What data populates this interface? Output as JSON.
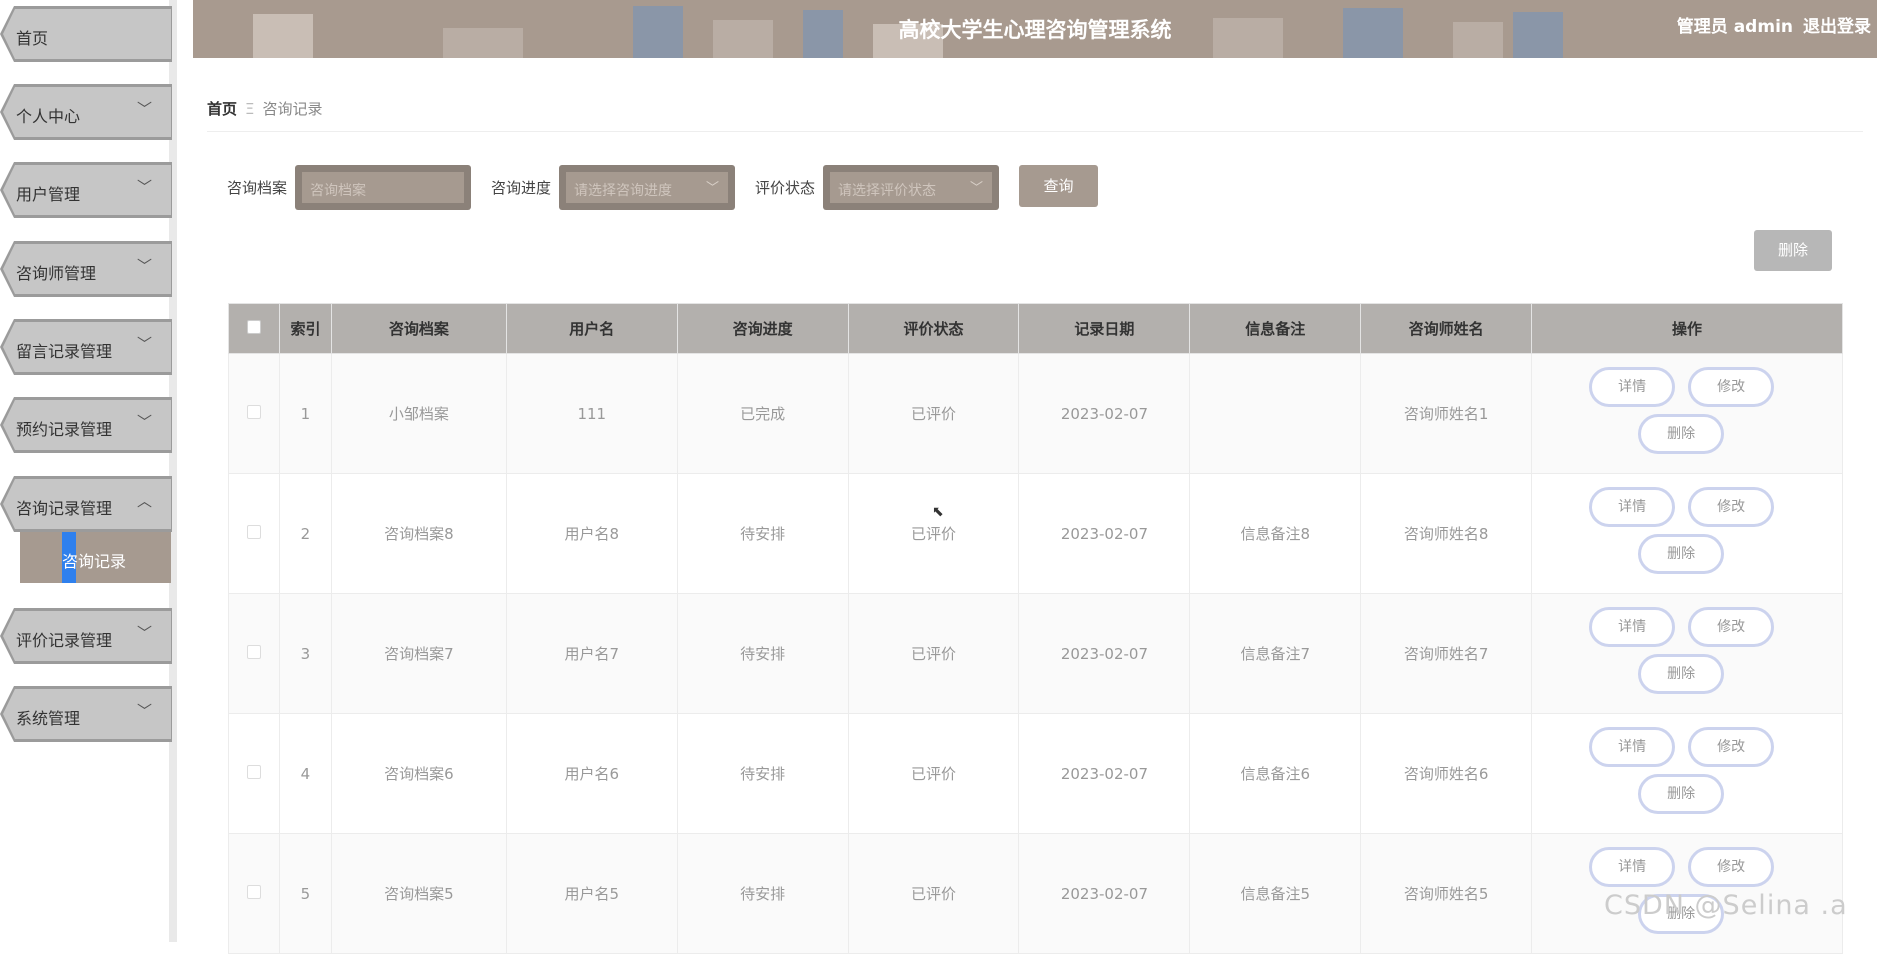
{
  "sidebar": {
    "items": [
      {
        "label": "首页",
        "chev": ""
      },
      {
        "label": "个人中心",
        "chev": "﹀"
      },
      {
        "label": "用户管理",
        "chev": "﹀"
      },
      {
        "label": "咨询师管理",
        "chev": "﹀"
      },
      {
        "label": "留言记录管理",
        "chev": "﹀"
      },
      {
        "label": "预约记录管理",
        "chev": "﹀"
      },
      {
        "label": "咨询记录管理",
        "chev": "︿"
      },
      {
        "label": "评价记录管理",
        "chev": "﹀"
      },
      {
        "label": "系统管理",
        "chev": "﹀"
      }
    ],
    "active_sub": "咨询记录"
  },
  "header": {
    "title": "高校大学生心理咨询管理系统",
    "user": "管理员 admin",
    "logout": "退出登录"
  },
  "breadcrumb": {
    "home": "首页",
    "sep": "Ξ",
    "current": "咨询记录"
  },
  "search": {
    "archive_label": "咨询档案",
    "archive_placeholder": "咨询档案",
    "progress_label": "咨询进度",
    "progress_placeholder": "请选择咨询进度",
    "eval_label": "评价状态",
    "eval_placeholder": "请选择评价状态",
    "query_button": "查询"
  },
  "toolbar": {
    "delete_button": "删除"
  },
  "table": {
    "headers": [
      "索引",
      "咨询档案",
      "用户名",
      "咨询进度",
      "评价状态",
      "记录日期",
      "信息备注",
      "咨询师姓名",
      "操作"
    ],
    "rows": [
      {
        "idx": "1",
        "archive": "小邹档案",
        "user": "111",
        "progress": "已完成",
        "eval": "已评价",
        "date": "2023-02-07",
        "note": "",
        "counselor": "咨询师姓名1"
      },
      {
        "idx": "2",
        "archive": "咨询档案8",
        "user": "用户名8",
        "progress": "待安排",
        "eval": "已评价",
        "date": "2023-02-07",
        "note": "信息备注8",
        "counselor": "咨询师姓名8"
      },
      {
        "idx": "3",
        "archive": "咨询档案7",
        "user": "用户名7",
        "progress": "待安排",
        "eval": "已评价",
        "date": "2023-02-07",
        "note": "信息备注7",
        "counselor": "咨询师姓名7"
      },
      {
        "idx": "4",
        "archive": "咨询档案6",
        "user": "用户名6",
        "progress": "待安排",
        "eval": "已评价",
        "date": "2023-02-07",
        "note": "信息备注6",
        "counselor": "咨询师姓名6"
      },
      {
        "idx": "5",
        "archive": "咨询档案5",
        "user": "用户名5",
        "progress": "待安排",
        "eval": "已评价",
        "date": "2023-02-07",
        "note": "信息备注5",
        "counselor": "咨询师姓名5"
      }
    ],
    "op_detail": "详情",
    "op_edit": "修改",
    "op_delete": "删除"
  },
  "watermark": "CSDN @Selina .a"
}
